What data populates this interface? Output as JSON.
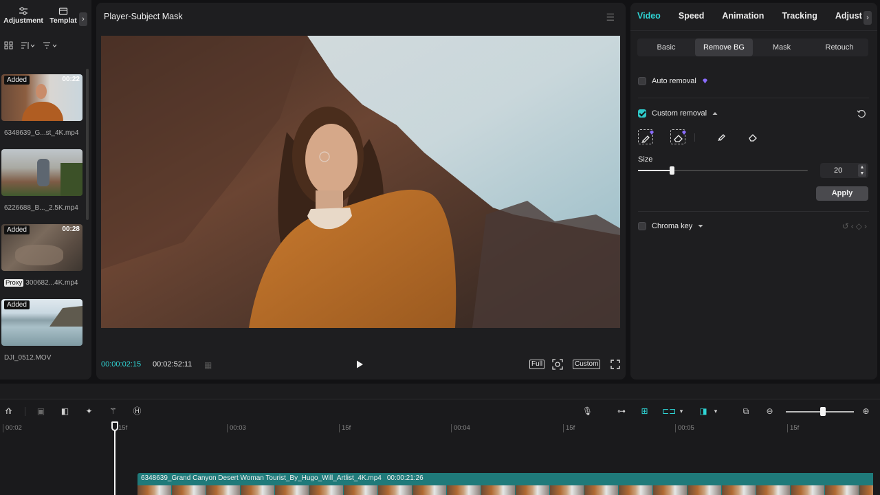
{
  "left_panel": {
    "tabs": [
      {
        "label": "Adjustment",
        "icon": "sliders-icon"
      },
      {
        "label": "Templat",
        "icon": "template-icon"
      }
    ],
    "tools": [
      "grid-view-icon",
      "sort-icon",
      "filter-icon"
    ],
    "media": [
      {
        "badge": "Added",
        "duration": "00:22",
        "name": "6348639_G...st_4K.mp4",
        "proxy": ""
      },
      {
        "badge": "",
        "duration": "",
        "name": "6226688_B..._2.5K.mp4",
        "proxy": ""
      },
      {
        "badge": "Added",
        "duration": "00:28",
        "name": "300682...4K.mp4",
        "proxy": "Proxy"
      },
      {
        "badge": "Added",
        "duration": "",
        "name": "DJI_0512.MOV",
        "proxy": ""
      }
    ]
  },
  "player": {
    "title": "Player-Subject Mask",
    "current_time": "00:00:02:15",
    "total_time": "00:02:52:11",
    "full_label": "Full",
    "custom_label": "Custom"
  },
  "inspector": {
    "tabs": [
      "Video",
      "Speed",
      "Animation",
      "Tracking",
      "Adjust"
    ],
    "active_tab": "Video",
    "subtabs": [
      "Basic",
      "Remove BG",
      "Mask",
      "Retouch"
    ],
    "active_subtab": "Remove BG",
    "auto_removal_label": "Auto removal",
    "custom_removal_label": "Custom removal",
    "size_label": "Size",
    "size_value": "20",
    "size_fraction": 0.2,
    "apply_label": "Apply",
    "chroma_key_label": "Chroma key"
  },
  "timeline": {
    "ruler": [
      {
        "label": "00:02"
      },
      {
        "label": "15f"
      },
      {
        "label": "00:03"
      },
      {
        "label": "15f"
      },
      {
        "label": "00:04"
      },
      {
        "label": "15f"
      },
      {
        "label": "00:05"
      },
      {
        "label": "15f"
      }
    ],
    "clip_name": "6348639_Grand Canyon Desert Woman Tourist_By_Hugo_Will_Artlist_4K.mp4",
    "clip_duration": "00:00:21:26",
    "zoom_fraction": 0.55
  },
  "colors": {
    "accent": "#2fd6d6",
    "clip": "#1f7a7a",
    "panel": "#1e1e20",
    "premium": "#8a6cff"
  }
}
